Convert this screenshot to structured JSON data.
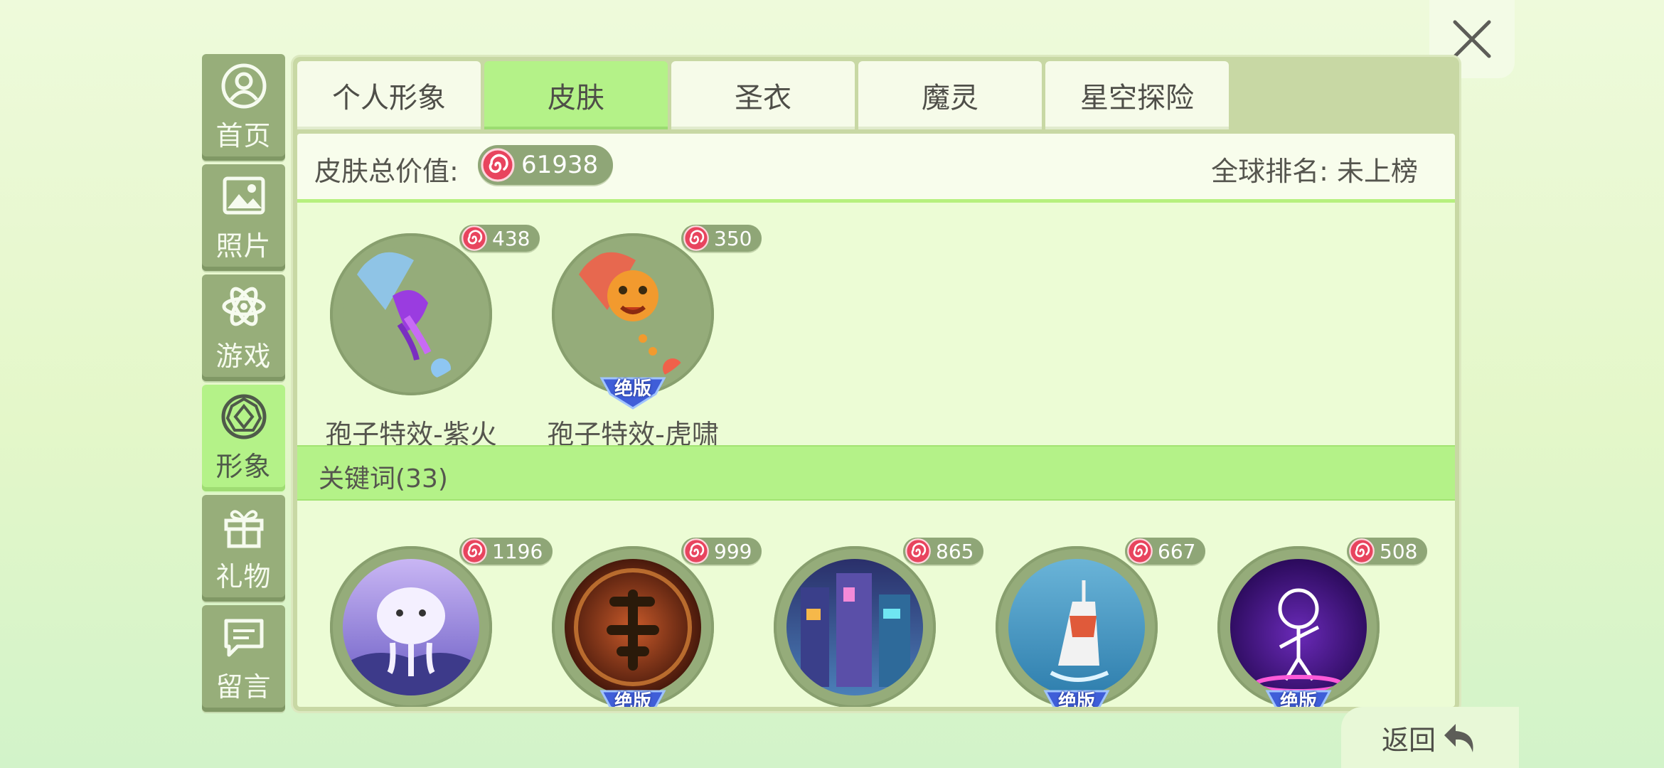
{
  "close": {
    "icon": "close-icon"
  },
  "sidebar": {
    "items": [
      {
        "label": "首页",
        "icon": "user-circle-icon",
        "active": false
      },
      {
        "label": "照片",
        "icon": "image-icon",
        "active": false
      },
      {
        "label": "游戏",
        "icon": "atom-icon",
        "active": false
      },
      {
        "label": "形象",
        "icon": "gem-icon",
        "active": true
      },
      {
        "label": "礼物",
        "icon": "gift-icon",
        "active": false
      },
      {
        "label": "留言",
        "icon": "message-icon",
        "active": false
      }
    ]
  },
  "tabs": [
    {
      "label": "个人形象",
      "active": false
    },
    {
      "label": "皮肤",
      "active": true
    },
    {
      "label": "圣衣",
      "active": false
    },
    {
      "label": "魔灵",
      "active": false
    },
    {
      "label": "星空探险",
      "active": false
    }
  ],
  "summary": {
    "total_label": "皮肤总价值:",
    "total_value": "61938",
    "rank_text": "全球排名: 未上榜"
  },
  "featured_items": [
    {
      "name": "孢子特效-紫火",
      "price": "438",
      "badge": ""
    },
    {
      "name": "孢子特效-虎啸",
      "price": "350",
      "badge": "绝版"
    }
  ],
  "keyword_section": {
    "label": "关键词(33)"
  },
  "keyword_items": [
    {
      "price": "1196",
      "badge": ""
    },
    {
      "price": "999",
      "badge": "绝版"
    },
    {
      "price": "865",
      "badge": ""
    },
    {
      "price": "667",
      "badge": "绝版"
    },
    {
      "price": "508",
      "badge": "绝版"
    }
  ],
  "footer": {
    "back_label": "返回"
  },
  "colors": {
    "active_green": "#b4f288",
    "inactive_tile": "#97ae7a",
    "pill": "#8fa677",
    "coin_red": "#e8445e"
  }
}
